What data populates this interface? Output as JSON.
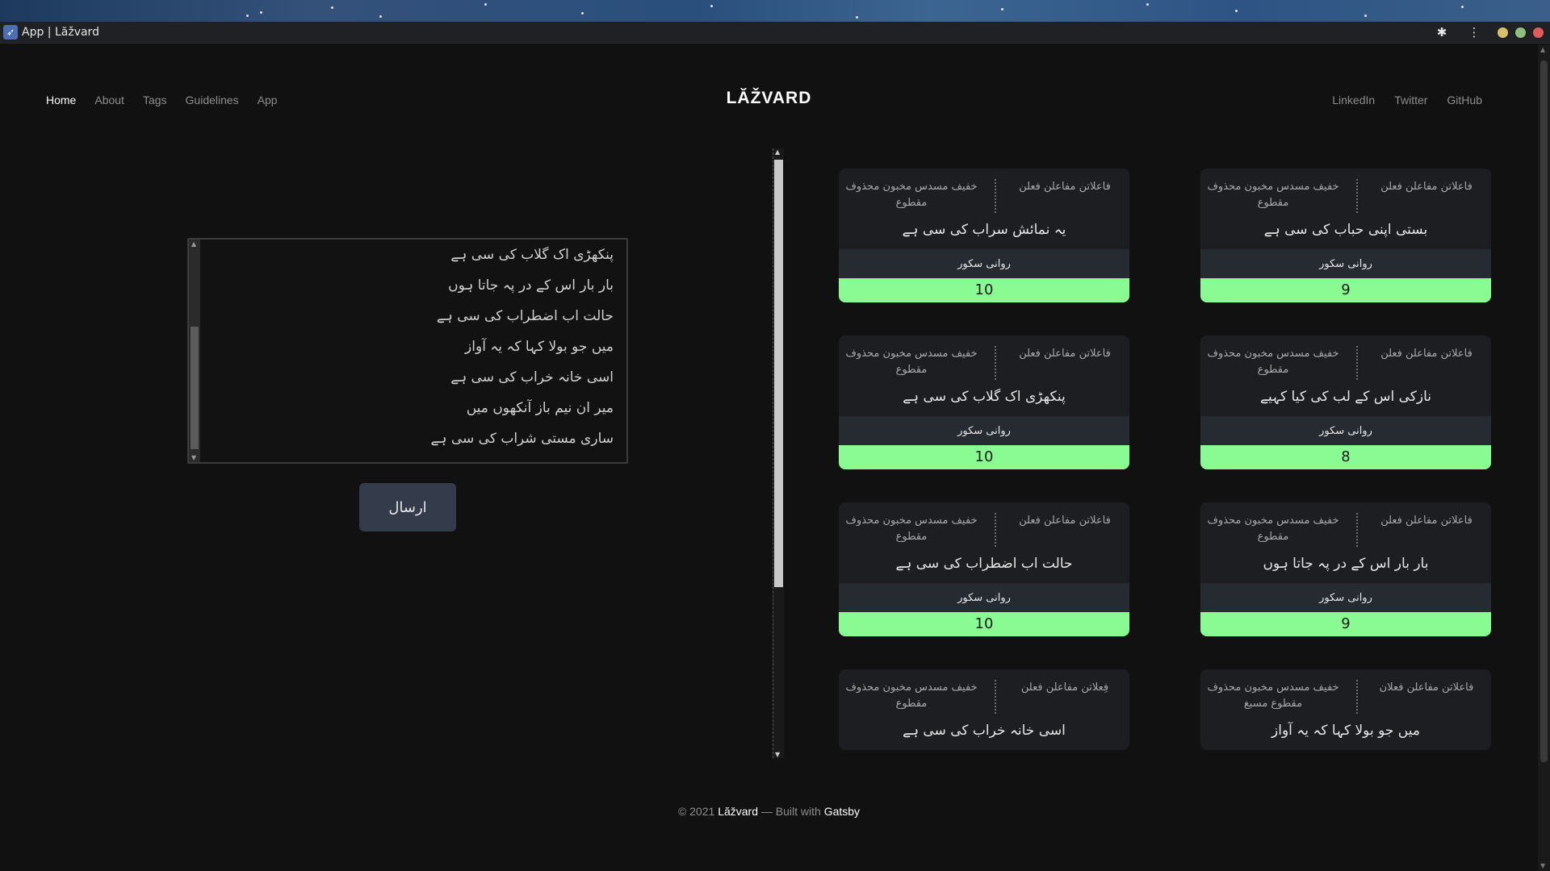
{
  "window": {
    "title": "App | Lăžvard"
  },
  "nav": {
    "left": [
      "Home",
      "About",
      "Tags",
      "Guidelines",
      "App"
    ],
    "brand": "LĂŽVARD",
    "right": [
      "LinkedIn",
      "Twitter",
      "GitHub"
    ]
  },
  "editor": {
    "lines": [
      "پنکھڑی اک گلاب کی سی ہے",
      "بار بار اس کے در پہ جاتا ہوں",
      "حالت اب اضطراب کی سی ہے",
      "میں جو بولا کہا کہ یہ آواز",
      "اسی خانہ خراب کی سی ہے",
      "میر ان نیم باز آنکھوں میں",
      "ساری مستی شراب کی سی ہے"
    ],
    "submit_label": "ارسال"
  },
  "cards": [
    {
      "meter_left": "خفیف مسدس مخبون محذوف مقطوع",
      "meter_right": "فاعلاتن مفاعلن فعلن",
      "verse": "بستی اپنی حباب کی سی ہے",
      "score_label": "روانی سکور",
      "score": "9"
    },
    {
      "meter_left": "خفیف مسدس مخبون محذوف مقطوع",
      "meter_right": "فاعلاتن مفاعلن فعلن",
      "verse": "یہ نمائش سراب کی سی ہے",
      "score_label": "روانی سکور",
      "score": "10"
    },
    {
      "meter_left": "خفیف مسدس مخبون محذوف مقطوع",
      "meter_right": "فاعلاتن مفاعلن فعلن",
      "verse": "نازکی اس کے لب کی کیا کہیے",
      "score_label": "روانی سکور",
      "score": "8"
    },
    {
      "meter_left": "خفیف مسدس مخبون محذوف مقطوع",
      "meter_right": "فاعلاتن مفاعلن فعلن",
      "verse": "پنکھڑی اک گلاب کی سی ہے",
      "score_label": "روانی سکور",
      "score": "10"
    },
    {
      "meter_left": "خفیف مسدس مخبون محذوف مقطوع",
      "meter_right": "فاعلاتن مفاعلن فعلن",
      "verse": "بار بار اس کے در پہ جاتا ہوں",
      "score_label": "روانی سکور",
      "score": "9"
    },
    {
      "meter_left": "خفیف مسدس مخبون محذوف مقطوع",
      "meter_right": "فاعلاتن مفاعلن فعلن",
      "verse": "حالت اب اضطراب کی سی ہے",
      "score_label": "روانی سکور",
      "score": "10"
    },
    {
      "meter_left": "خفیف مسدس مخبون محذوف مقطوع مسبغ",
      "meter_right": "فاعلاتن مفاعلن فعلان",
      "verse": "میں جو بولا کہا کہ یہ آواز",
      "score_label": "",
      "score": ""
    },
    {
      "meter_left": "خفیف مسدس مخبون محذوف مقطوع",
      "meter_right": "فِعلاتن مفاعلن فعلن",
      "verse": "اسی خانہ خراب کی سی ہے",
      "score_label": "",
      "score": ""
    }
  ],
  "footer": {
    "prefix": "© 2021 ",
    "brand": "Lăžvard",
    "middle": " — Built with ",
    "link": "Gatsby"
  },
  "colors": {
    "background": "#111111",
    "card": "#1c1e22",
    "score_bar": "#8afa93",
    "button": "#343b4a"
  }
}
